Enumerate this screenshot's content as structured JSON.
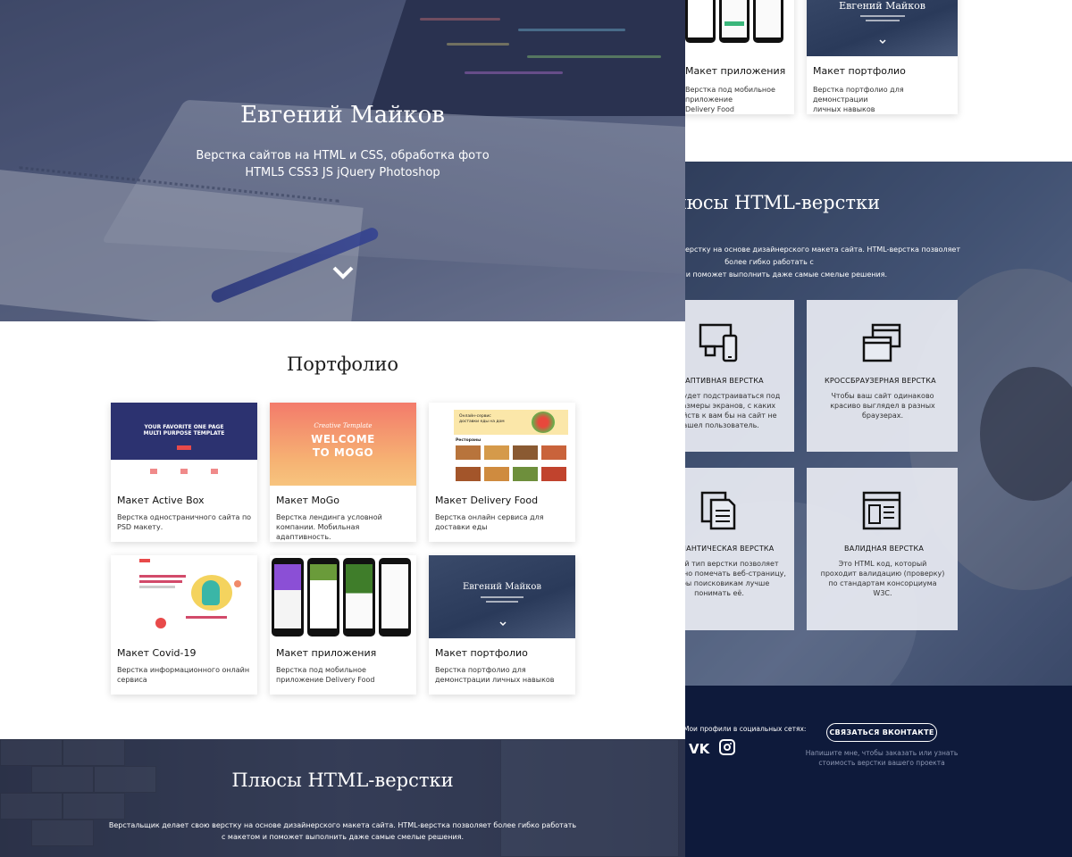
{
  "hero": {
    "title": "Евгений Майков",
    "subtitle_line1": "Верстка сайтов на HTML и CSS, обработка фото",
    "subtitle_line2": "HTML5 CSS3 JS jQuery Photoshop",
    "down_icon": "chevron-down-icon"
  },
  "portfolio": {
    "title": "Портфолио",
    "cards": [
      {
        "title": "Макет Active Box",
        "desc": "Верстка одностраничного сайта по PSD макету.",
        "thumb_text1": "YOUR FAVORITE ONE PAGE",
        "thumb_text2": "MULTI PURPOSE TEMPLATE"
      },
      {
        "title": "Макет MoGo",
        "desc": "Верстка лендинга условной компании. Мобильная адаптивность.",
        "thumb_script": "Creative Template",
        "thumb_text1": "WELCOME",
        "thumb_text2": "TO MOGO"
      },
      {
        "title": "Макет Delivery Food",
        "desc": "Верстка онлайн сервиса для доставки еды",
        "thumb_text1": "Онлайн-сервис",
        "thumb_text2": "доставки еды на дом",
        "thumb_text3": "Рестораны"
      },
      {
        "title": "Макет Covid-19",
        "desc": "Верстка информационного онлайн сервиса"
      },
      {
        "title": "Макет приложения",
        "desc": "Верстка под мобильное приложение Delivery Food"
      },
      {
        "title": "Макет портфолио",
        "desc": "Верстка портфолио для демонстрации личных навыков",
        "thumb_text1": "Евгений Майков"
      }
    ]
  },
  "plus_section": {
    "title": "Плюсы HTML-верстки",
    "desc": "Верстальщик делает свою верстку на основе дизайнерского макета сайта. HTML-верстка позволяет более гибко работать с макетом и поможет выполнить даже самые смелые решения."
  },
  "right_top": {
    "cards": [
      {
        "title": "Макет приложения",
        "desc_line1": "Верстка под мобильное приложение",
        "desc_line2": "Delivery Food"
      },
      {
        "title": "Макет портфолио",
        "desc_line1": "Верстка портфолио для демонстрации",
        "desc_line2": "личных навыков",
        "thumb_text1": "Евгений Майков"
      }
    ]
  },
  "right_plus": {
    "title": "Плюсы HTML-верстки",
    "desc_line1": "Верстальщик делает свою верстку на основе дизайнерского макета сайта. HTML-верстка позволяет более гибко работать с",
    "desc_line2": "макетом и поможет выполнить даже самые смелые решения.",
    "features": [
      {
        "title": "АДАПТИВНАЯ ВЕРСТКА",
        "desc": "Сайт будет подстраиваться под все размеры экранов, с каких устройств к вам бы на сайт не зашел пользователь.",
        "icon": "devices-icon"
      },
      {
        "title": "КРОССБРАУЗЕРНАЯ ВЕРСТКА",
        "desc": "Чтобы ваш сайт одинаково красиво выглядел в разных браузерах.",
        "icon": "browser-windows-icon"
      },
      {
        "title": "СЕМАНТИЧЕСКАЯ ВЕРСТКА",
        "desc": "Данный тип верстки позволяет правильно помечать веб-страницу, чтобы поисковикам лучше понимать её.",
        "icon": "documents-icon"
      },
      {
        "title": "ВАЛИДНАЯ ВЕРСТКА",
        "desc": "Это HTML код, который проходит валидацию (проверку) по стандартам консорциума W3C.",
        "icon": "webpage-layout-icon"
      }
    ]
  },
  "footer": {
    "social_label": "Мои профили в социальных сетях:",
    "vk_label": "VK",
    "contact_button": "СВЯЗАТЬСЯ ВКОНТАКТЕ",
    "note_line1": "Напишите мне, чтобы заказать или узнать",
    "note_line2": "стоимость верстки вашего проекта"
  },
  "colors": {
    "hero_overlay": "#4b5575",
    "footer_bg": "#0e1a3b",
    "feature_card_bg": "#e8ebf2"
  }
}
